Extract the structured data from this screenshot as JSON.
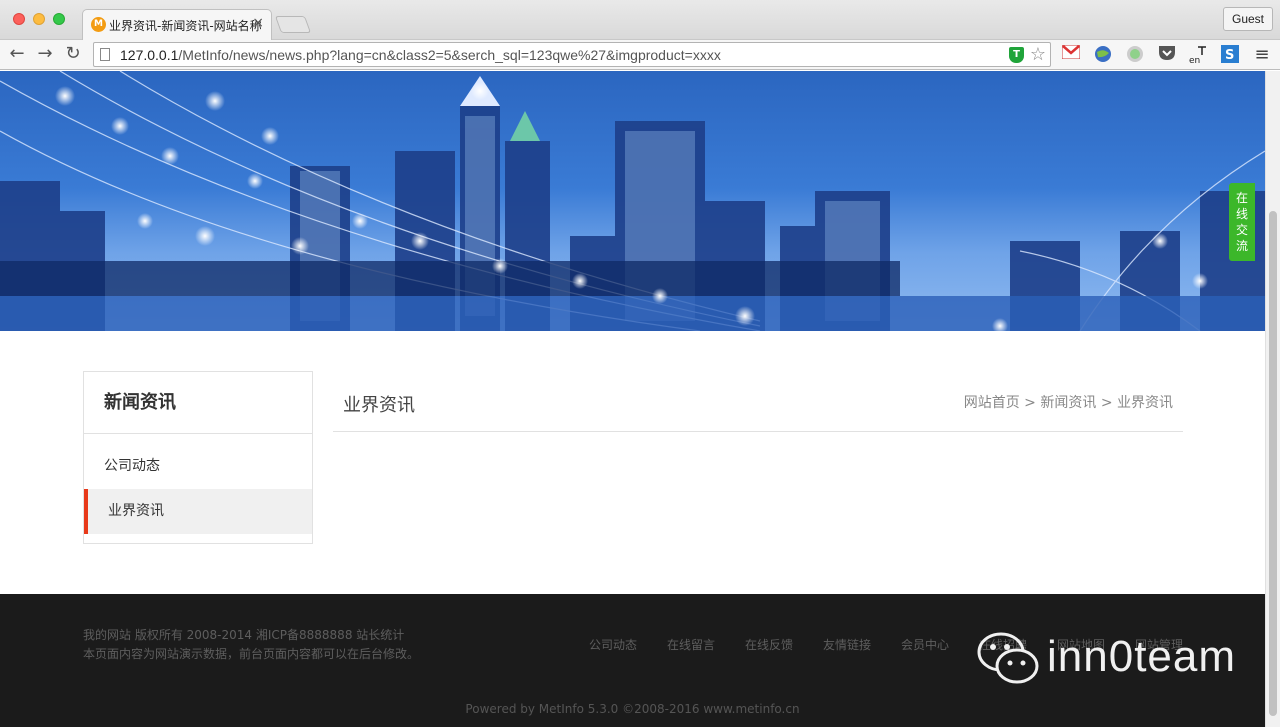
{
  "browser": {
    "tab_title": "业界资讯-新闻资讯-网站名称",
    "tab_close": "×",
    "guest_label": "Guest",
    "url_host": "127.0.0.1",
    "url_path": "/MetInfo/news/news.php?lang=cn&class2=5&serch_sql=123qwe%27&imgproduct=xxxx",
    "back_icon": "←",
    "forward_icon": "→",
    "reload_icon": "↻",
    "star_icon": "☆",
    "menu_icon": "≡",
    "shield_letter": "T",
    "favicon_letter": "M"
  },
  "side_tag": {
    "chars": [
      "在",
      "线",
      "交",
      "流"
    ]
  },
  "sidebar": {
    "title": "新闻资讯",
    "items": [
      {
        "label": "公司动态",
        "active": false
      },
      {
        "label": "业界资讯",
        "active": true
      }
    ]
  },
  "content": {
    "title": "业界资讯",
    "breadcrumb": "网站首页 > 新闻资讯 > 业界资讯"
  },
  "footer": {
    "line1": "我的网站 版权所有 2008-2014 湘ICP备8888888 站长统计",
    "line2": "本页面内容为网站演示数据，前台页面内容都可以在后台修改。",
    "nav": [
      "公司动态",
      "在线留言",
      "在线反馈",
      "友情链接",
      "会员中心",
      "在线招聘",
      "网站地图",
      "网站管理"
    ],
    "powered": "Powered by MetInfo 5.3.0 ©2008-2016 www.metinfo.cn"
  },
  "watermark": {
    "text": "inn0team"
  }
}
